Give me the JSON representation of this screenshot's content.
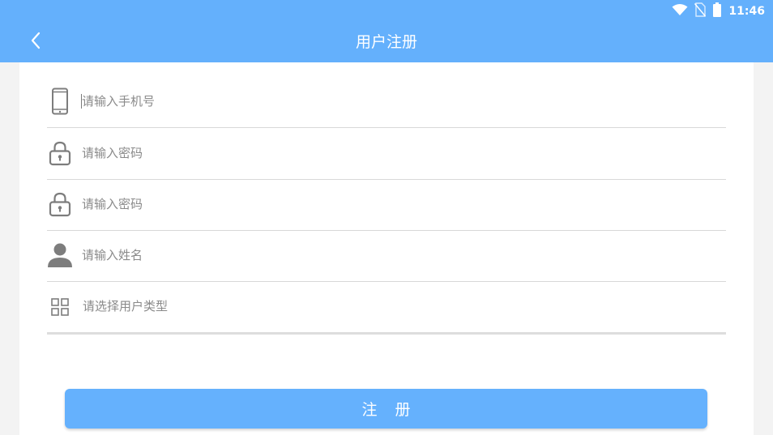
{
  "status_bar": {
    "time": "11:46",
    "icons": [
      "wifi-icon",
      "no-sim-icon",
      "battery-icon"
    ]
  },
  "header": {
    "back_icon": "chevron-left-icon",
    "title": "用户注册"
  },
  "form": {
    "phone": {
      "icon": "phone-icon",
      "placeholder": "请输入手机号",
      "value": ""
    },
    "password": {
      "icon": "lock-icon",
      "placeholder": "请输入密码",
      "value": ""
    },
    "password_confirm": {
      "icon": "lock-icon",
      "placeholder": "请输入密码",
      "value": ""
    },
    "name": {
      "icon": "person-icon",
      "placeholder": "请输入姓名",
      "value": ""
    },
    "user_type": {
      "icon": "grid-icon",
      "label": "请选择用户类型"
    }
  },
  "register_button": {
    "label": "注册"
  },
  "colors": {
    "primary": "#64b0fc",
    "button": "#65b1fd",
    "icon": "#7d7d7d",
    "divider": "#d8d8d8"
  }
}
